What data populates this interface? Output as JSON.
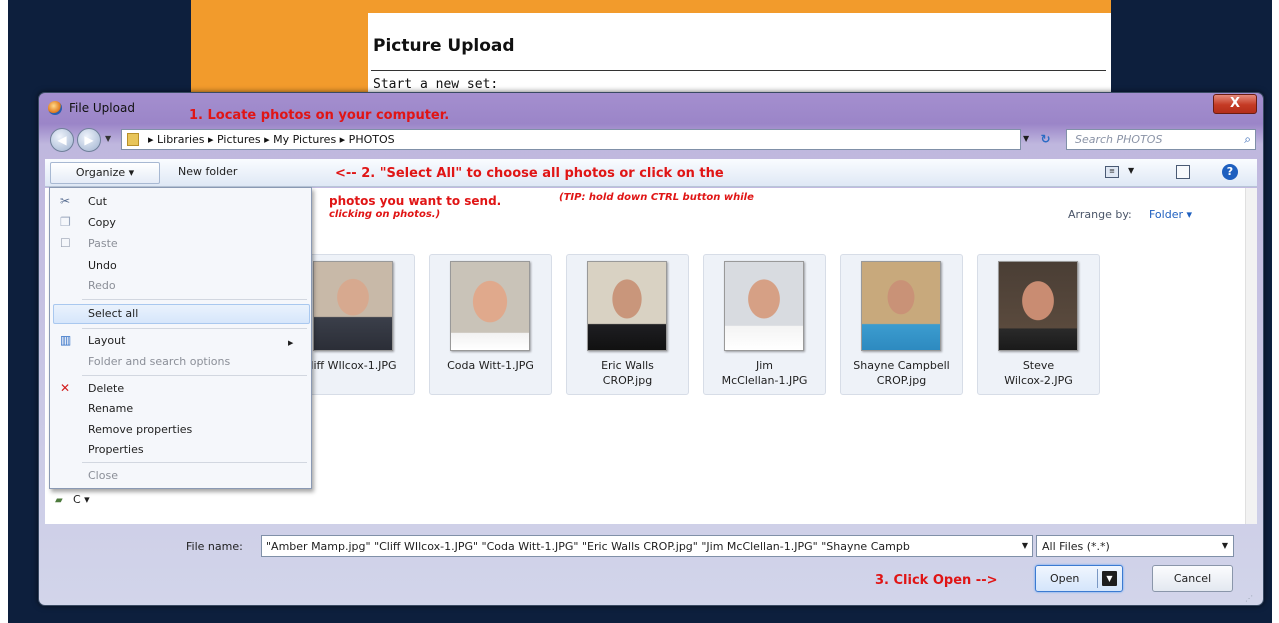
{
  "webpage": {
    "title": "Picture Upload",
    "subtitle": "Start a new set:"
  },
  "dialog": {
    "title": "File Upload",
    "close_label": "X"
  },
  "annotations": {
    "step1": "1. Locate photos on your computer.",
    "step2": "<-- 2. \"Select All\" to choose all photos or click on the",
    "step2_cont": "photos you want to send.",
    "step2_tip": "(TIP: hold down CTRL button while",
    "step2_tip_cont": "clicking on photos.)",
    "step3": "3. Click Open -->"
  },
  "address": {
    "crumbs": "▸ Libraries ▸ Pictures ▸ My Pictures ▸ PHOTOS",
    "search_placeholder": "Search PHOTOS"
  },
  "toolbar": {
    "organize": "Organize ▾",
    "new_folder": "New folder"
  },
  "arrange": {
    "label": "Arrange by:",
    "value": "Folder ▾"
  },
  "menu": {
    "items": [
      {
        "label": "Cut",
        "icon": "scissors-icon",
        "enabled": true
      },
      {
        "label": "Copy",
        "icon": "copy-icon",
        "enabled": true
      },
      {
        "label": "Paste",
        "icon": "paste-icon",
        "enabled": false
      },
      {
        "label": "Undo",
        "enabled": true
      },
      {
        "label": "Redo",
        "enabled": false
      },
      {
        "label": "Select all",
        "enabled": true
      },
      {
        "label": "Layout",
        "icon": "layout-icon",
        "enabled": true
      },
      {
        "label": "Folder and search options",
        "enabled": false
      },
      {
        "label": "Delete",
        "icon": "delete-icon",
        "enabled": true
      },
      {
        "label": "Rename",
        "enabled": true
      },
      {
        "label": "Remove properties",
        "enabled": true
      },
      {
        "label": "Properties",
        "enabled": true
      },
      {
        "label": "Close",
        "enabled": false
      }
    ]
  },
  "files": [
    {
      "name": "Cliff WIlcox-1.JPG",
      "shown": "liff WIlcox-1.JPG"
    },
    {
      "name": "Coda Witt-1.JPG"
    },
    {
      "name": "Eric Walls CROP.jpg",
      "line1": "Eric Walls",
      "line2": "CROP.jpg"
    },
    {
      "name": "Jim McClellan-1.JPG",
      "line1": "Jim",
      "line2": "McClellan-1.JPG"
    },
    {
      "name": "Shayne Campbell CROP.jpg",
      "line1": "Shayne Campbell",
      "line2": "CROP.jpg"
    },
    {
      "name": "Steve Wilcox-2.JPG",
      "line1": "Steve",
      "line2": "Wilcox-2.JPG"
    }
  ],
  "left_pane": {
    "partial_item": "C"
  },
  "bottom": {
    "file_name_label": "File name:",
    "file_name_value": "\"Amber Mamp.jpg\" \"Cliff WIlcox-1.JPG\" \"Coda Witt-1.JPG\" \"Eric Walls CROP.jpg\" \"Jim McClellan-1.JPG\" \"Shayne Campb",
    "file_type": "All Files (*.*)",
    "open_label": "Open",
    "cancel_label": "Cancel"
  }
}
